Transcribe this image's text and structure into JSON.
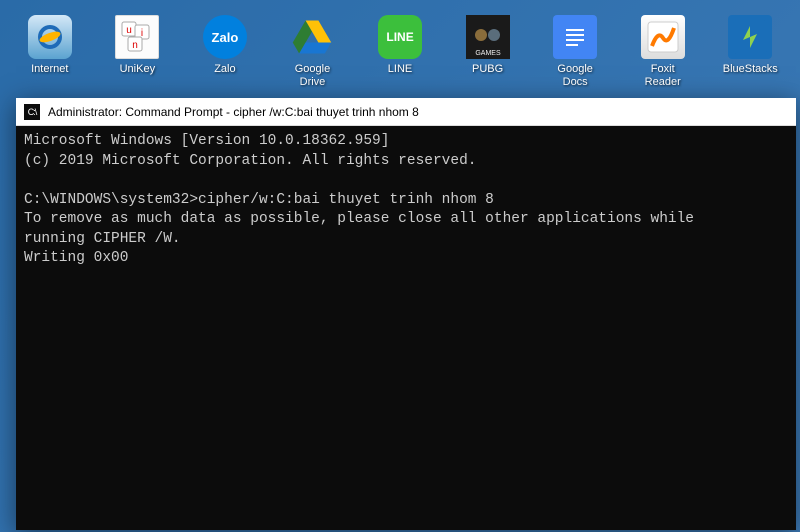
{
  "desktop": {
    "icons": [
      {
        "name": "internet-explorer",
        "label": "Internet"
      },
      {
        "name": "unikey",
        "label": "UniKey"
      },
      {
        "name": "zalo",
        "label": "Zalo"
      },
      {
        "name": "google-drive",
        "label": "Google Drive"
      },
      {
        "name": "line",
        "label": "LINE"
      },
      {
        "name": "pubg-mobile",
        "label": "PUBG"
      },
      {
        "name": "google-docs",
        "label": "Google Docs"
      },
      {
        "name": "foxit-reader",
        "label": "Foxit Reader"
      },
      {
        "name": "bluestacks",
        "label": "BlueStacks"
      }
    ]
  },
  "cmd": {
    "title": "Administrator: Command Prompt - cipher /w:C:bai thuyet trinh nhom 8",
    "lines": {
      "l1": "Microsoft Windows [Version 10.0.18362.959]",
      "l2": "(c) 2019 Microsoft Corporation. All rights reserved.",
      "l3": "",
      "l4": "C:\\WINDOWS\\system32>cipher/w:C:bai thuyet trinh nhom 8",
      "l5": "To remove as much data as possible, please close all other applications while",
      "l6": "running CIPHER /W.",
      "l7": "Writing 0x00"
    }
  }
}
